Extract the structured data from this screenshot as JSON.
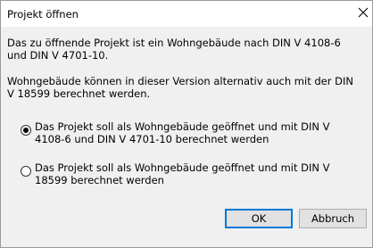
{
  "window": {
    "title": "Projekt öffnen",
    "close_icon": "close-icon"
  },
  "message": {
    "line1": "Das zu öffnende Projekt ist ein Wohngebäude nach DIN V 4108-6 und DIN V 4701-10.",
    "line2": "Wohngebäude können in dieser Version alternativ auch mit der DIN V 18599 berechnet werden."
  },
  "options": [
    {
      "label": "Das Projekt soll als Wohngebäude geöffnet und mit DIN V 4108-6 und DIN V 4701-10 berechnet werden",
      "selected": true
    },
    {
      "label": "Das Projekt soll als Wohngebäude geöffnet und mit DIN V 18599 berechnet werden",
      "selected": false
    }
  ],
  "buttons": {
    "ok": "OK",
    "cancel": "Abbruch"
  },
  "colors": {
    "accent": "#0078d7",
    "dialog_bg": "#f0f0f0",
    "title_bg": "#ffffff"
  }
}
